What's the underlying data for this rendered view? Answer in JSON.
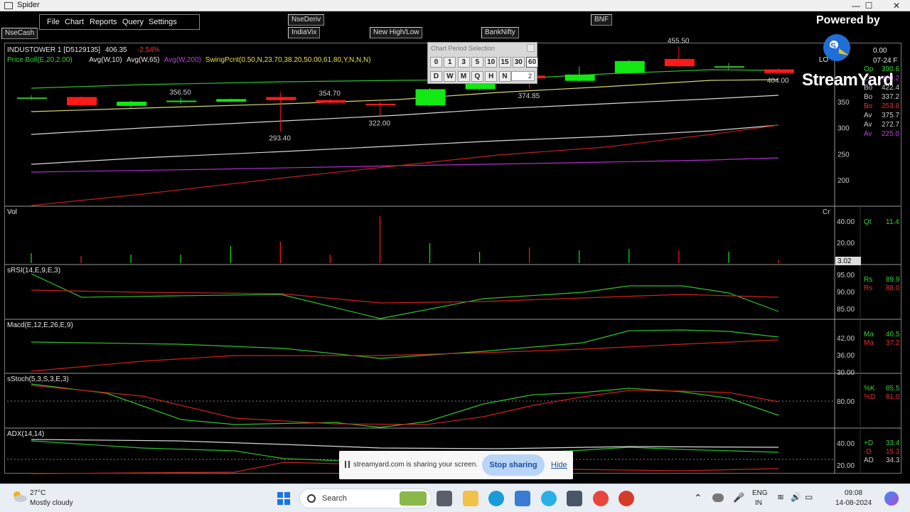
{
  "window": {
    "title": "Spider",
    "minimize_glyph": "—",
    "maximize_glyph": "☐",
    "close_glyph": "✕"
  },
  "menu": {
    "file": "File",
    "chart": "Chart",
    "reports": "Reports",
    "query": "Query",
    "settings": "Settings"
  },
  "toolbar": {
    "nsecash": "NseCash",
    "nsederiv": "NseDeriv",
    "indiavix": "IndiaVix",
    "new_high_low": "New High/Low",
    "banknifty": "BankNifty",
    "bnf": "BNF"
  },
  "chart_header": {
    "symbol": "INDUSTOWER 1 [D5129135]",
    "price": "406.35",
    "change": "-2.54%",
    "indicators": [
      {
        "text": "Price Boll(E,20,2.00)",
        "color": "#36d436"
      },
      {
        "text": "Avg(W,10)",
        "color": "#e8e8e8"
      },
      {
        "text": "Avg(W,65)",
        "color": "#e8e8e8"
      },
      {
        "text": "Avg(W,200)",
        "color": "#c040e0"
      },
      {
        "text": "SwingPcnt(0.50,N,23.70,38.20,50.00,61.80,Y,N,N,N)",
        "color": "#e8e040"
      }
    ]
  },
  "chart_data": {
    "type": "candlestick",
    "price_ticks": [
      "350",
      "300",
      "250",
      "200"
    ],
    "swing_labels": [
      {
        "label": "356.50",
        "value": 356.5
      },
      {
        "label": "354.70",
        "value": 354.7
      },
      {
        "label": "293.40",
        "value": 293.4
      },
      {
        "label": "322.00",
        "value": 322.0
      },
      {
        "label": "374.85",
        "value": 374.85
      },
      {
        "label": "455.50",
        "value": 455.5
      },
      {
        "label": "404.00",
        "value": 404.0
      }
    ],
    "candles": [
      {
        "open": 358,
        "close": 358,
        "high": 362,
        "low": 354,
        "dir": "flat"
      },
      {
        "open": 359,
        "close": 343,
        "high": 360,
        "low": 340,
        "dir": "down"
      },
      {
        "open": 342,
        "close": 350,
        "high": 352,
        "low": 336,
        "dir": "up"
      },
      {
        "open": 350,
        "close": 352,
        "high": 357,
        "low": 346,
        "dir": "up"
      },
      {
        "open": 350,
        "close": 355,
        "high": 356,
        "low": 349,
        "dir": "up"
      },
      {
        "open": 359,
        "close": 353,
        "high": 368,
        "low": 293,
        "dir": "down"
      },
      {
        "open": 353,
        "close": 348,
        "high": 355,
        "low": 345,
        "dir": "down"
      },
      {
        "open": 346,
        "close": 344,
        "high": 349,
        "low": 322,
        "dir": "down"
      },
      {
        "open": 343,
        "close": 374,
        "high": 376,
        "low": 341,
        "dir": "up"
      },
      {
        "open": 374,
        "close": 390,
        "high": 395,
        "low": 372,
        "dir": "up"
      },
      {
        "open": 400,
        "close": 395,
        "high": 402,
        "low": 375,
        "dir": "down"
      },
      {
        "open": 390,
        "close": 402,
        "high": 418,
        "low": 388,
        "dir": "up"
      },
      {
        "open": 405,
        "close": 428,
        "high": 430,
        "low": 404,
        "dir": "up"
      },
      {
        "open": 432,
        "close": 418,
        "high": 455,
        "low": 415,
        "dir": "down"
      },
      {
        "open": 418,
        "close": 416,
        "high": 424,
        "low": 410,
        "dir": "flat"
      },
      {
        "open": 412,
        "close": 405,
        "high": 414,
        "low": 404,
        "dir": "down"
      }
    ],
    "volume": {
      "label": "Vol",
      "ticks": [
        "40.00",
        "20.00"
      ],
      "readout": "3.02",
      "side": "Cr"
    },
    "panels": [
      {
        "name": "rsi",
        "label": "sRSI(14,E,9,E,3)",
        "ticks": [
          "95.00",
          "90.00",
          "85.00"
        ]
      },
      {
        "name": "macd",
        "label": "Macd(E,12,E,26,E,9)",
        "ticks": [
          "42.00",
          "36.00",
          "30.00"
        ]
      },
      {
        "name": "stoch",
        "label": "sStoch(5,3,S,3,E,3)",
        "ticks": [
          "80.00"
        ]
      },
      {
        "name": "adx",
        "label": "ADX(14,14)",
        "ticks": [
          "40.00",
          "20.00"
        ]
      }
    ]
  },
  "right_panel": {
    "top_value": "0.00",
    "date": "07-24 F",
    "lo": "LO",
    "rows": [
      {
        "k": "Op",
        "v": "390.6",
        "color": "#36d436"
      },
      {
        "k": "Cl",
        "v": "409.2",
        "color": "#c040e0"
      },
      {
        "k": "Bo",
        "v": "422.4",
        "color": "#cccccc"
      },
      {
        "k": "Bo",
        "v": "337.2",
        "color": "#cccccc"
      },
      {
        "k": "Bo",
        "v": "253.8",
        "color": "#e03030"
      },
      {
        "k": "Av",
        "v": "375.7",
        "color": "#cccccc"
      },
      {
        "k": "Av",
        "v": "272.7",
        "color": "#cccccc"
      },
      {
        "k": "Av",
        "v": "225.0",
        "color": "#c040e0"
      }
    ],
    "qt": {
      "k": "Qt",
      "v": "11.4"
    },
    "rsi": [
      {
        "k": "Rs",
        "v": "89.9",
        "color": "#36d436"
      },
      {
        "k": "Rs",
        "v": "88.0",
        "color": "#e03030"
      }
    ],
    "macd": [
      {
        "k": "Ma",
        "v": "40.5",
        "color": "#36d436"
      },
      {
        "k": "Ma",
        "v": "37.2",
        "color": "#e03030"
      }
    ],
    "stoch": [
      {
        "k": "%K",
        "v": "85.5",
        "color": "#36d436"
      },
      {
        "k": "%D",
        "v": "81.0",
        "color": "#e03030"
      }
    ],
    "adx": [
      {
        "k": "+D",
        "v": "33.4",
        "color": "#36d436"
      },
      {
        "k": "-D",
        "v": "15.3",
        "color": "#e03030"
      },
      {
        "k": "AD",
        "v": "34.3",
        "color": "#cccccc"
      }
    ]
  },
  "period_selection": {
    "title": "Chart Period Selection",
    "minute_buttons": [
      "0",
      "1",
      "3",
      "5",
      "10",
      "15",
      "30",
      "60"
    ],
    "selected": "60",
    "period_buttons": [
      "D",
      "W",
      "M",
      "Q",
      "H",
      "N"
    ],
    "input_value": "2"
  },
  "streamyard": {
    "powered_by": "Powered by",
    "logo_text": "StreamYard",
    "share_message": "streamyard.com is sharing your screen.",
    "stop_label": "Stop sharing",
    "hide_label": "Hide"
  },
  "taskbar": {
    "temperature": "27°C",
    "weather": "Mostly cloudy",
    "search_label": "Search",
    "lang_top": "ENG",
    "lang_bottom": "IN",
    "time": "09:08",
    "date": "14-08-2024"
  },
  "colors": {
    "up_candle": "#12e812",
    "down_candle": "#ff1a1a",
    "green_line": "#2fc22f",
    "red_line": "#e02020",
    "purple_line": "#b030d0",
    "white_line": "#d8d8d8",
    "yellow_line": "#d8d870",
    "taskbar_bg": "#e9eef4"
  }
}
